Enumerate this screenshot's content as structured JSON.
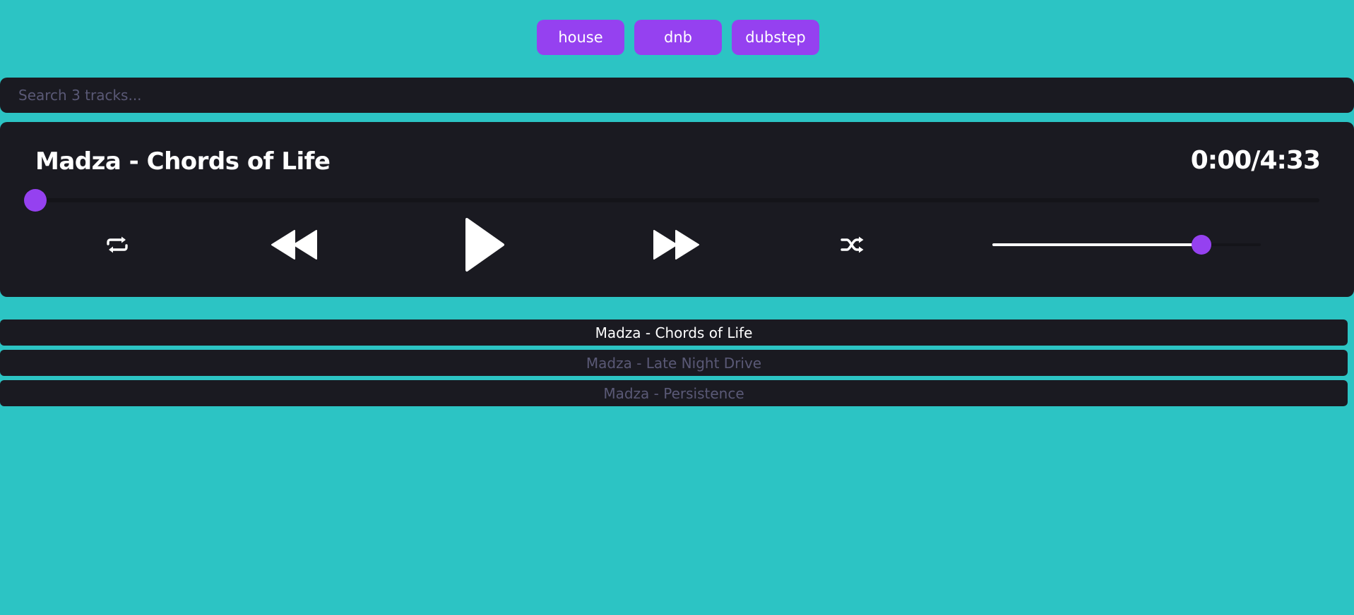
{
  "genres": [
    "house",
    "dnb",
    "dubstep"
  ],
  "search": {
    "placeholder": "Search 3 tracks..."
  },
  "player": {
    "title": "Madza - Chords of Life",
    "current_time": "0:00",
    "duration": "4:33",
    "progress_fraction": 0.0,
    "volume_fraction": 0.78
  },
  "controls": {
    "loop_icon": "repeat-icon",
    "prev_icon": "rewind-icon",
    "play_icon": "play-icon",
    "next_icon": "fast-forward-icon",
    "shuffle_icon": "shuffle-icon"
  },
  "tracks": [
    {
      "title": "Madza - Chords of Life",
      "active": true
    },
    {
      "title": "Madza - Late Night Drive",
      "active": false
    },
    {
      "title": "Madza - Persistence",
      "active": false
    }
  ],
  "colors": {
    "background": "#2cc4c4",
    "panel": "#1a1a21",
    "accent": "#9541f0",
    "muted_text": "#5a5976",
    "text": "#ffffff"
  }
}
